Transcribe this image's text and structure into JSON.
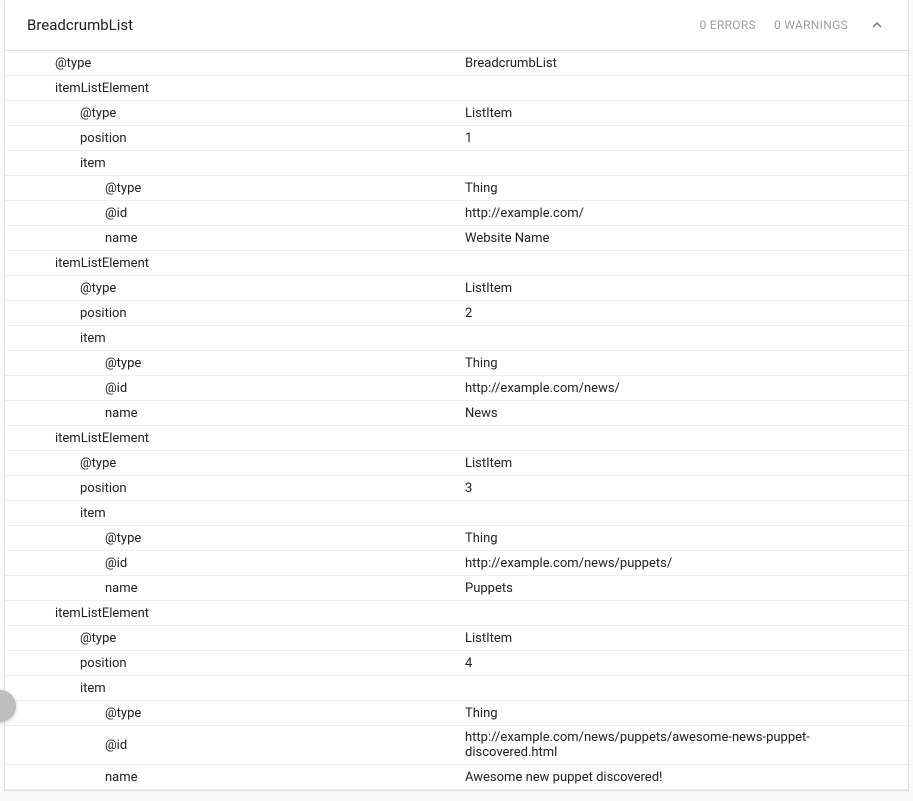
{
  "header": {
    "title": "BreadcrumbList",
    "errors_label": "0 ERRORS",
    "warnings_label": "0 WARNINGS"
  },
  "rows": [
    {
      "indent": 0,
      "key": "@type",
      "value": "BreadcrumbList"
    },
    {
      "indent": 0,
      "key": "itemListElement",
      "value": ""
    },
    {
      "indent": 1,
      "key": "@type",
      "value": "ListItem"
    },
    {
      "indent": 1,
      "key": "position",
      "value": "1"
    },
    {
      "indent": 1,
      "key": "item",
      "value": ""
    },
    {
      "indent": 2,
      "key": "@type",
      "value": "Thing"
    },
    {
      "indent": 2,
      "key": "@id",
      "value": "http://example.com/"
    },
    {
      "indent": 2,
      "key": "name",
      "value": "Website Name"
    },
    {
      "indent": 0,
      "key": "itemListElement",
      "value": ""
    },
    {
      "indent": 1,
      "key": "@type",
      "value": "ListItem"
    },
    {
      "indent": 1,
      "key": "position",
      "value": "2"
    },
    {
      "indent": 1,
      "key": "item",
      "value": ""
    },
    {
      "indent": 2,
      "key": "@type",
      "value": "Thing"
    },
    {
      "indent": 2,
      "key": "@id",
      "value": "http://example.com/news/"
    },
    {
      "indent": 2,
      "key": "name",
      "value": "News"
    },
    {
      "indent": 0,
      "key": "itemListElement",
      "value": ""
    },
    {
      "indent": 1,
      "key": "@type",
      "value": "ListItem"
    },
    {
      "indent": 1,
      "key": "position",
      "value": "3"
    },
    {
      "indent": 1,
      "key": "item",
      "value": ""
    },
    {
      "indent": 2,
      "key": "@type",
      "value": "Thing"
    },
    {
      "indent": 2,
      "key": "@id",
      "value": "http://example.com/news/puppets/"
    },
    {
      "indent": 2,
      "key": "name",
      "value": "Puppets"
    },
    {
      "indent": 0,
      "key": "itemListElement",
      "value": ""
    },
    {
      "indent": 1,
      "key": "@type",
      "value": "ListItem"
    },
    {
      "indent": 1,
      "key": "position",
      "value": "4"
    },
    {
      "indent": 1,
      "key": "item",
      "value": ""
    },
    {
      "indent": 2,
      "key": "@type",
      "value": "Thing"
    },
    {
      "indent": 2,
      "key": "@id",
      "value": "http://example.com/news/puppets/awesome-news-puppet-discovered.html"
    },
    {
      "indent": 2,
      "key": "name",
      "value": "Awesome new puppet discovered!"
    }
  ]
}
